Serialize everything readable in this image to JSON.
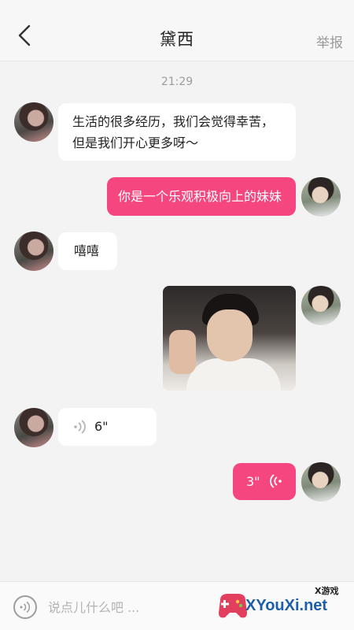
{
  "header": {
    "title": "黛西",
    "report_label": "举报"
  },
  "chat": {
    "timestamp": "21:29",
    "messages": [
      {
        "side": "left",
        "type": "text",
        "line1": "生活的很多经历，我们会觉得幸苦，",
        "line2": "但是我们开心更多呀～"
      },
      {
        "side": "right",
        "type": "text",
        "text": "你是一个乐观积极向上的妹妹"
      },
      {
        "side": "left",
        "type": "text",
        "text": "嘻嘻"
      },
      {
        "side": "right",
        "type": "image"
      },
      {
        "side": "left",
        "type": "voice",
        "duration": "6\""
      },
      {
        "side": "right",
        "type": "voice",
        "duration": "3\""
      }
    ]
  },
  "input": {
    "placeholder": "说点儿什么吧 ..."
  },
  "watermark": {
    "text": "XYouXi.net",
    "small": "X游戏"
  },
  "colors": {
    "accent": "#f5467f",
    "background": "#f3f3f3",
    "bubble_left": "#ffffff"
  }
}
